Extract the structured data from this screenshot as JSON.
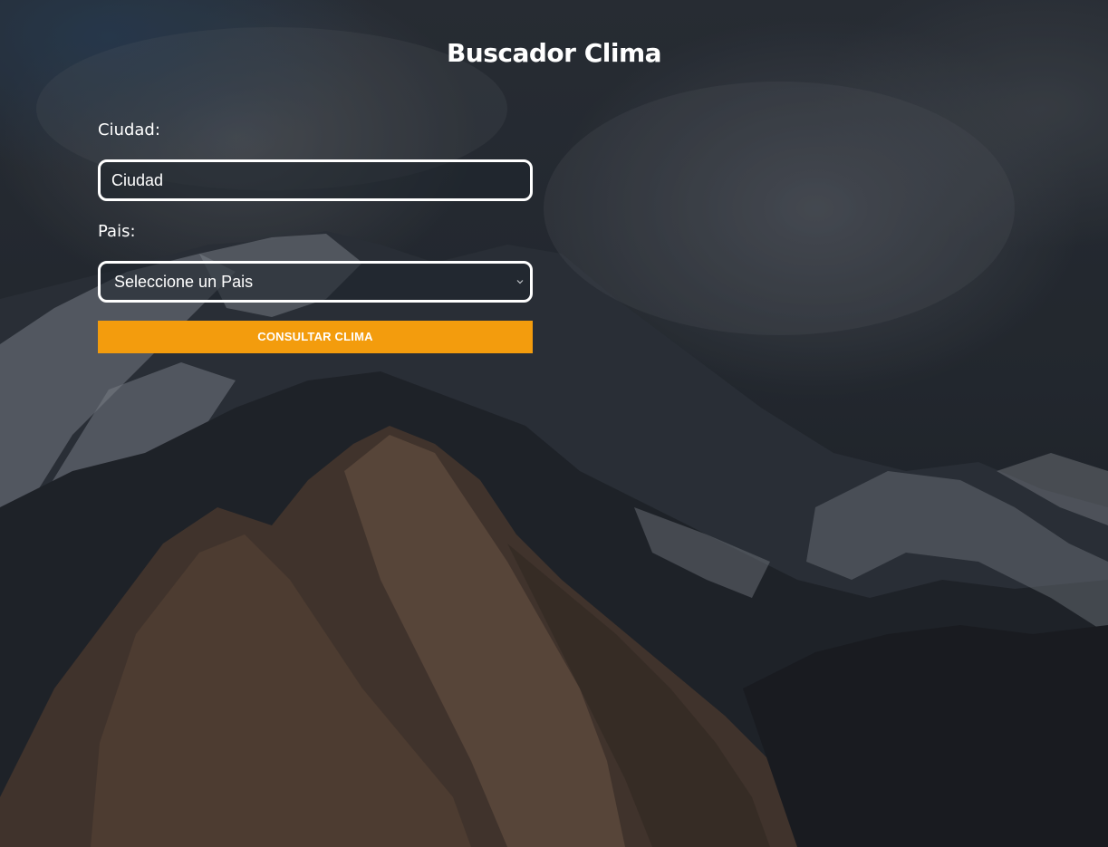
{
  "header": {
    "title": "Buscador Clima"
  },
  "form": {
    "city_label": "Ciudad:",
    "city_value": "Ciudad",
    "country_label": "Pais:",
    "country_selected": "Seleccione un Pais",
    "submit_label": "CONSULTAR CLIMA"
  },
  "colors": {
    "accent": "#f39c0d",
    "text": "#ffffff"
  },
  "icons": {
    "select_arrow": "chevron-down-icon"
  }
}
